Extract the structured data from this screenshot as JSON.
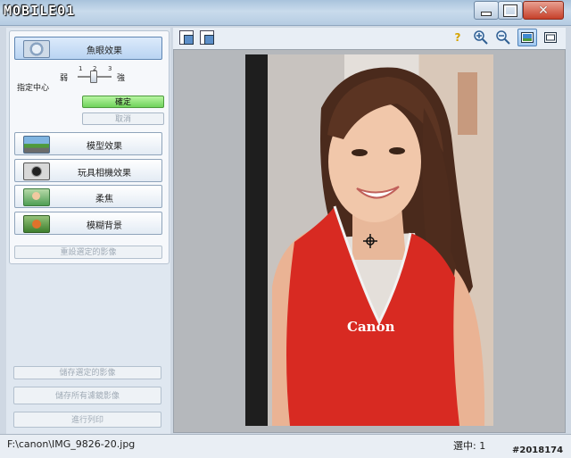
{
  "window": {
    "brand": "MOBILE01",
    "min_icon": "minimize-icon",
    "max_icon": "maximize-icon",
    "close_icon": "close-icon"
  },
  "effects": {
    "fisheye": {
      "label": "魚眼效果",
      "icon": "fisheye-icon"
    },
    "slider": {
      "weak": "弱",
      "strong": "強",
      "ticks": [
        "1",
        "2",
        "3"
      ],
      "value": 2
    },
    "specify_center": "指定中心",
    "ok": "確定",
    "cancel": "取消",
    "miniature": {
      "label": "模型效果",
      "icon": "miniature-icon"
    },
    "toy_camera": {
      "label": "玩具相機效果",
      "icon": "camera-icon"
    },
    "soft_focus": {
      "label": "柔焦",
      "icon": "soft-focus-icon"
    },
    "blur_background": {
      "label": "模糊背景",
      "icon": "blur-background-icon"
    },
    "reset": "重設選定的影像"
  },
  "actions": {
    "save_selected": "儲存選定的影像",
    "save_all": "儲存所有濾鏡影像",
    "print": "進行列印"
  },
  "toolbar": {
    "left": [
      "rotate-left-icon",
      "rotate-right-icon"
    ],
    "right": [
      "help-icon",
      "zoom-in-icon",
      "zoom-out-icon",
      "single-view-icon",
      "full-screen-icon"
    ],
    "selected": "single-view-icon"
  },
  "preview": {
    "brand_text": "Canon"
  },
  "status": {
    "path": "F:\\canon\\IMG_9826-20.jpg",
    "selected": "選中: 1",
    "tag": "#2018174"
  },
  "colors": {
    "accent": "#4f82b8",
    "ok_green": "#6fd25b",
    "dress_red": "#d82a22"
  }
}
